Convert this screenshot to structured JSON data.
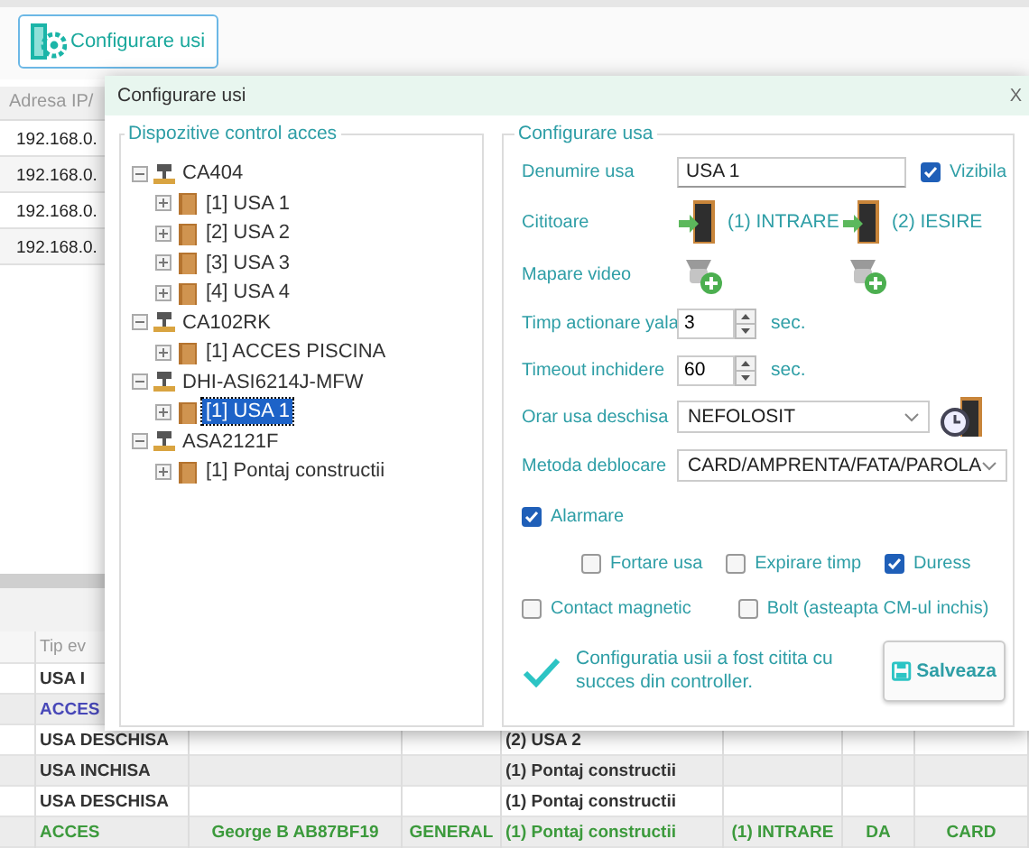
{
  "toolbar": {
    "button": "Configurare usi"
  },
  "devices_table": {
    "columns": [
      "Adresa IP/"
    ],
    "rows": [
      [
        "192.168.0."
      ],
      [
        "192.168.0."
      ],
      [
        "192.168.0."
      ],
      [
        "192.168.0."
      ]
    ]
  },
  "events_table": {
    "columns": [
      "",
      "Tip ev"
    ],
    "rows": [
      {
        "color": "#333333",
        "cells": [
          "",
          "USA I"
        ]
      },
      {
        "color": "#4848b8",
        "cells": [
          "",
          "ACCES"
        ]
      },
      {
        "color": "#333333",
        "cells": [
          "",
          "USA DESCHISA",
          "",
          "",
          "(2) USA 2"
        ]
      },
      {
        "color": "#333333",
        "cells": [
          "",
          "USA INCHISA",
          "",
          "",
          "(1) Pontaj constructii",
          "",
          "",
          ""
        ]
      },
      {
        "color": "#333333",
        "cells": [
          "",
          "USA DESCHISA",
          "",
          "",
          "(1) Pontaj constructii",
          "",
          "",
          ""
        ]
      },
      {
        "color": "#3c9a3c",
        "cells": [
          "",
          "ACCES",
          "George B AB87BF19",
          "GENERAL",
          "(1) Pontaj constructii",
          "(1) INTRARE",
          "DA",
          "CARD"
        ]
      }
    ]
  },
  "dialog": {
    "title": "Configurare usi",
    "close": "X",
    "devices": {
      "title": "Dispozitive control acces",
      "tree": [
        {
          "label": "CA404",
          "kind": "controller",
          "expanded": true,
          "selected": false,
          "children": [
            {
              "label": "[1] USA 1",
              "kind": "door",
              "expanded": false,
              "selected": false
            },
            {
              "label": "[2] USA 2",
              "kind": "door",
              "expanded": false,
              "selected": false
            },
            {
              "label": "[3] USA 3",
              "kind": "door",
              "expanded": false,
              "selected": false
            },
            {
              "label": "[4] USA 4",
              "kind": "door",
              "expanded": false,
              "selected": false
            }
          ]
        },
        {
          "label": "CA102RK",
          "kind": "controller",
          "expanded": true,
          "selected": false,
          "children": [
            {
              "label": "[1] ACCES PISCINA",
              "kind": "door",
              "expanded": false,
              "selected": false
            }
          ]
        },
        {
          "label": "DHI-ASI6214J-MFW",
          "kind": "controller",
          "expanded": true,
          "selected": false,
          "children": [
            {
              "label": "[1] USA 1",
              "kind": "door",
              "expanded": false,
              "selected": true
            }
          ]
        },
        {
          "label": "ASA2121F",
          "kind": "controller",
          "expanded": true,
          "selected": false,
          "children": [
            {
              "label": "[1] Pontaj constructii",
              "kind": "door",
              "expanded": false,
              "selected": false
            }
          ]
        }
      ]
    },
    "door": {
      "title": "Configurare usa",
      "name": {
        "label": "Denumire usa",
        "value": "USA 1"
      },
      "visible": {
        "label": "Vizibila",
        "checked": true
      },
      "readers": {
        "label": "Cititoare",
        "items": [
          "(1) INTRARE",
          "(2) IESIRE"
        ]
      },
      "video": {
        "label": "Mapare video",
        "cameras": [
          {
            "kind": "add"
          },
          {
            "kind": "add"
          }
        ]
      },
      "lock_time": {
        "label": "Timp actionare yala",
        "value": "3",
        "unit": "sec."
      },
      "close_timeout": {
        "label": "Timeout inchidere",
        "value": "60",
        "unit": "sec."
      },
      "open_schedule": {
        "label": "Orar usa deschisa",
        "value": "NEFOLOSIT"
      },
      "unlock_method": {
        "label": "Metoda deblocare",
        "value": "CARD/AMPRENTA/FATA/PAROLA"
      },
      "alarm": {
        "label": "Alarmare",
        "checked": true,
        "options": [
          {
            "label": "Fortare usa",
            "checked": false
          },
          {
            "label": "Expirare timp",
            "checked": false
          },
          {
            "label": "Duress",
            "checked": true
          }
        ]
      },
      "extra": [
        {
          "label": "Contact magnetic",
          "checked": false
        },
        {
          "label": "Bolt (asteapta CM-ul inchis)",
          "checked": false
        }
      ],
      "status": "Configuratia usii a fost citita cu succes din controller.",
      "save": "Salveaza"
    }
  }
}
